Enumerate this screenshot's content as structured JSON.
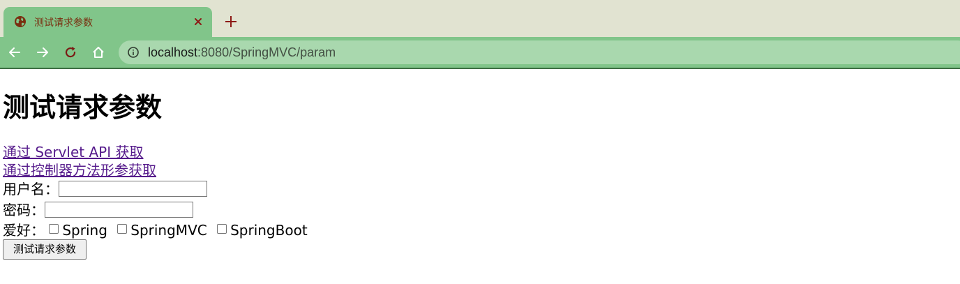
{
  "browser": {
    "tab": {
      "title": "测试请求参数",
      "favicon": "globe-icon",
      "close_icon": "close-icon"
    },
    "new_tab_icon": "plus-icon",
    "toolbar": {
      "back_icon": "arrow-left-icon",
      "forward_icon": "arrow-right-icon",
      "reload_icon": "reload-icon",
      "home_icon": "home-icon",
      "info_icon": "info-icon"
    },
    "address": {
      "host": "localhost",
      "path": ":8080/SpringMVC/param"
    },
    "colors": {
      "tabstrip": "#e1e3d1",
      "toolbar": "#81c58a",
      "omnibox": "#a9d8ae",
      "accent": "#8d1a16"
    }
  },
  "page": {
    "heading": "测试请求参数",
    "links": [
      {
        "label": "通过 Servlet API 获取"
      },
      {
        "label": "通过控制器方法形参获取"
      }
    ],
    "form": {
      "username_label": "用户名：",
      "username_value": "",
      "password_label": "密码：",
      "password_value": "",
      "hobby_label": "爱好：",
      "hobbies": [
        {
          "label": "Spring",
          "checked": false
        },
        {
          "label": "SpringMVC",
          "checked": false
        },
        {
          "label": "SpringBoot",
          "checked": false
        }
      ],
      "submit_label": "测试请求参数"
    },
    "colors": {
      "link_visited": "#551a8b"
    }
  }
}
